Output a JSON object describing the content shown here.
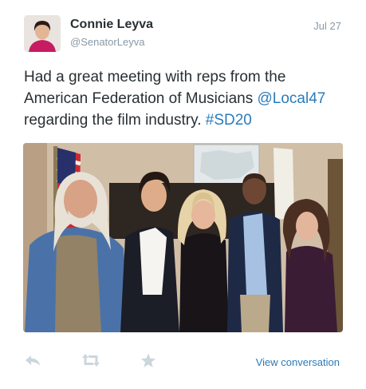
{
  "tweet": {
    "author_name": "Connie Leyva",
    "author_handle": "@SenatorLeyva",
    "date": "Jul 27",
    "text_part1": "Had a great meeting with reps from the American Federation of Musicians ",
    "mention": "@Local47",
    "text_part2": " regarding the film industry. ",
    "hashtag": "#SD20"
  },
  "actions": {
    "reply_icon": "reply-icon",
    "retweet_icon": "retweet-icon",
    "favorite_icon": "favorite-icon",
    "view_conversation": "View conversation"
  },
  "colors": {
    "link": "#2b7bb9",
    "text": "#292f33",
    "muted": "#8899a6",
    "icon": "#ccd6dd"
  }
}
